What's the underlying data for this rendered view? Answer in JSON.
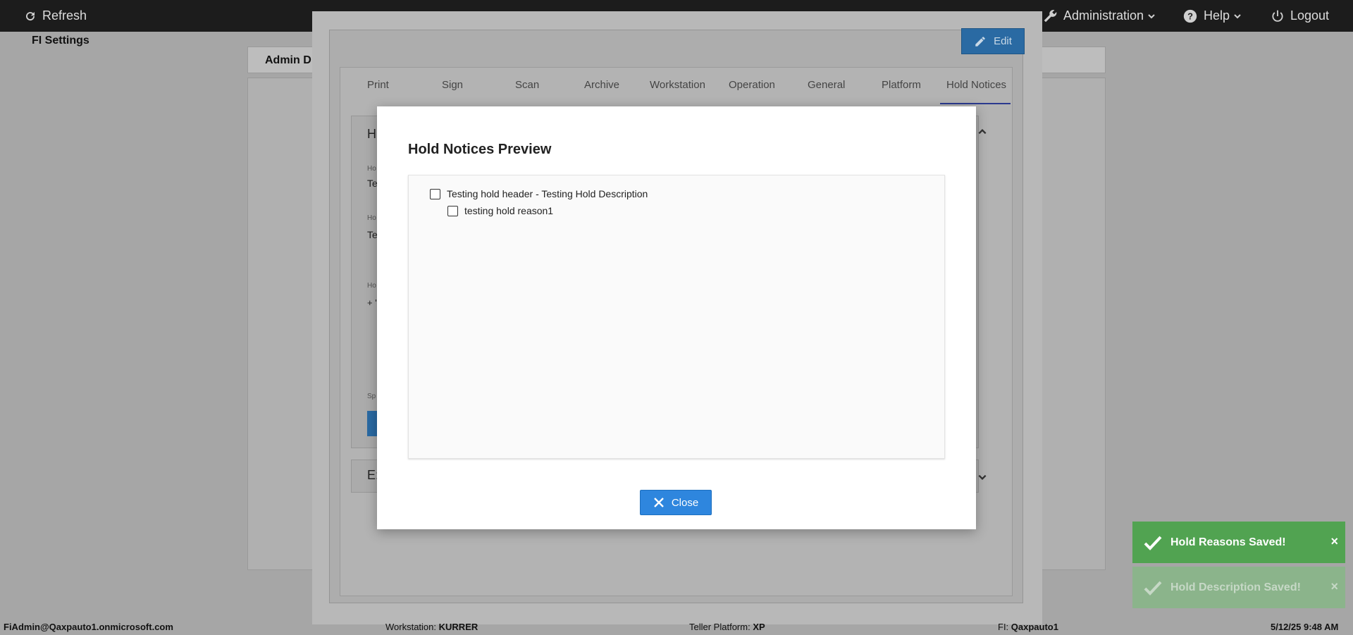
{
  "topbar": {
    "refresh_label": "Refresh",
    "administration_label": "Administration",
    "help_label": "Help",
    "logout_label": "Logout"
  },
  "background": {
    "header_title": "Admin D"
  },
  "fi_settings": {
    "title": "FI Settings",
    "edit_label": "Edit",
    "tabs": [
      {
        "label": "Print"
      },
      {
        "label": "Sign"
      },
      {
        "label": "Scan"
      },
      {
        "label": "Archive"
      },
      {
        "label": "Workstation"
      },
      {
        "label": "Operation"
      },
      {
        "label": "General"
      },
      {
        "label": "Platform"
      },
      {
        "label": "Hold Notices"
      }
    ],
    "active_tab": "Hold Notices",
    "section1_initial": "H",
    "section2_initial": "E:",
    "field1_label": "Ho",
    "field1_value": "Te",
    "field2_label": "Ho",
    "field2_value": "Te",
    "field3_label": "Ho",
    "field3_value": "+ '",
    "field4_label": "Sp"
  },
  "modal": {
    "title": "Hold Notices Preview",
    "items": [
      {
        "label": "Testing hold header - Testing Hold Description",
        "checked": false
      },
      {
        "label": "testing hold reason1",
        "checked": false
      }
    ],
    "close_label": "Close"
  },
  "toasts": [
    {
      "message": "Hold Reasons Saved!",
      "close": "×"
    },
    {
      "message": "Hold Description Saved!",
      "close": "×"
    }
  ],
  "footer": {
    "user": "FiAdmin@Qaxpauto1.onmicrosoft.com",
    "workstation_label": "Workstation:",
    "workstation_value": "KURRER",
    "platform_label": "Teller Platform:",
    "platform_value": "XP",
    "fi_label": "FI:",
    "fi_value": "Qaxpauto1",
    "datetime": "5/12/25 9:48 AM"
  },
  "colors": {
    "primary_button": "#2e86de",
    "toast_success": "#51a351",
    "topbar": "#1c1c1c",
    "tab_active_underline": "#2b3a8f"
  }
}
